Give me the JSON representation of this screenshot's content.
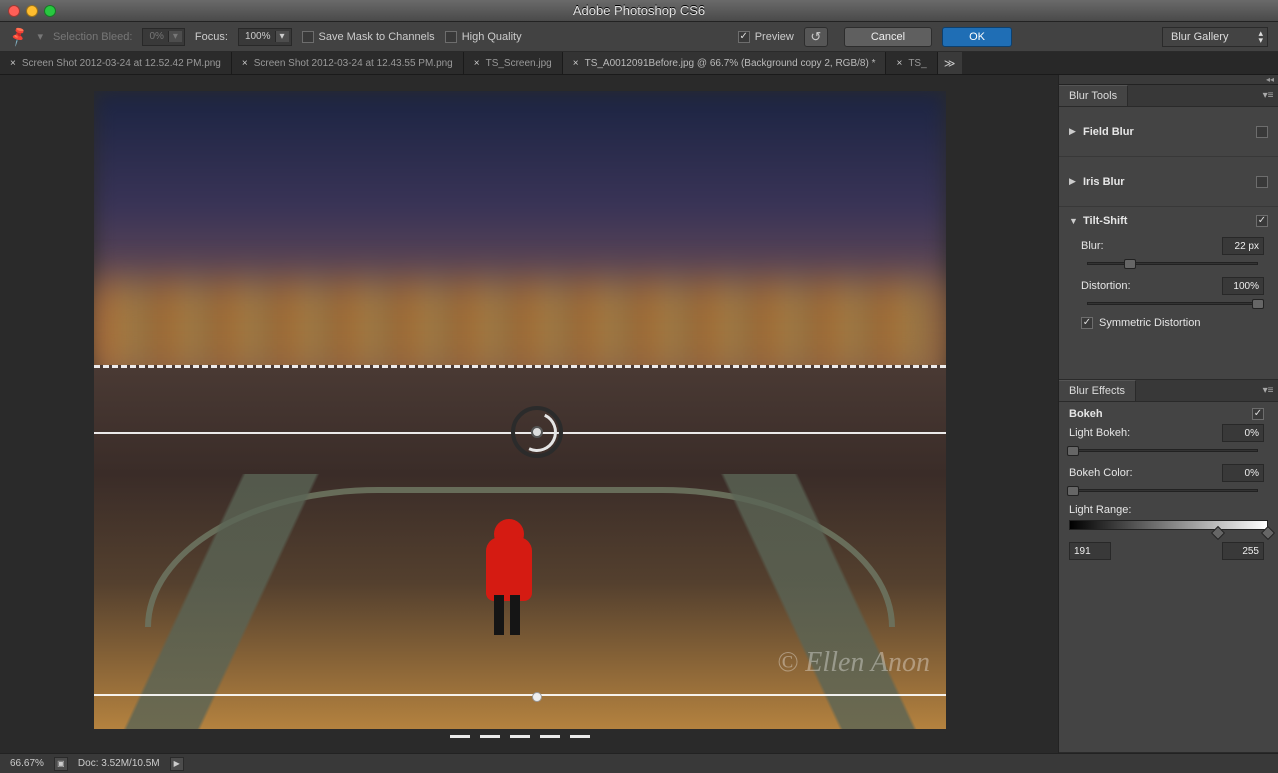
{
  "app_title": "Adobe Photoshop CS6",
  "tabs": [
    "Screen Shot 2012-03-24 at 12.52.42 PM.png",
    "Screen Shot 2012-03-24 at 12.43.55 PM.png",
    "TS_Screen.jpg",
    "TS_A0012091Before.jpg @ 66.7% (Background copy 2, RGB/8) *",
    "TS_"
  ],
  "options": {
    "selection_bleed_label": "Selection Bleed:",
    "selection_bleed_value": "0%",
    "focus_label": "Focus:",
    "focus_value": "100%",
    "save_mask_label": "Save Mask to Channels",
    "high_quality_label": "High Quality",
    "preview_label": "Preview",
    "cancel": "Cancel",
    "ok": "OK"
  },
  "right_dd": "Blur Gallery",
  "blur_tools": {
    "tab": "Blur Tools",
    "field_blur": "Field Blur",
    "iris_blur": "Iris Blur",
    "tilt_shift": "Tilt-Shift",
    "blur_label": "Blur:",
    "blur_value": "22 px",
    "distortion_label": "Distortion:",
    "distortion_value": "100%",
    "symmetric_label": "Symmetric Distortion"
  },
  "blur_effects": {
    "tab": "Blur Effects",
    "bokeh": "Bokeh",
    "light_bokeh_label": "Light Bokeh:",
    "light_bokeh_value": "0%",
    "bokeh_color_label": "Bokeh Color:",
    "bokeh_color_value": "0%",
    "light_range_label": "Light Range:",
    "range_lo": "191",
    "range_hi": "255"
  },
  "status": {
    "zoom": "66.67%",
    "doc": "Doc: 3.52M/10.5M"
  },
  "watermark": "© Ellen Anon"
}
